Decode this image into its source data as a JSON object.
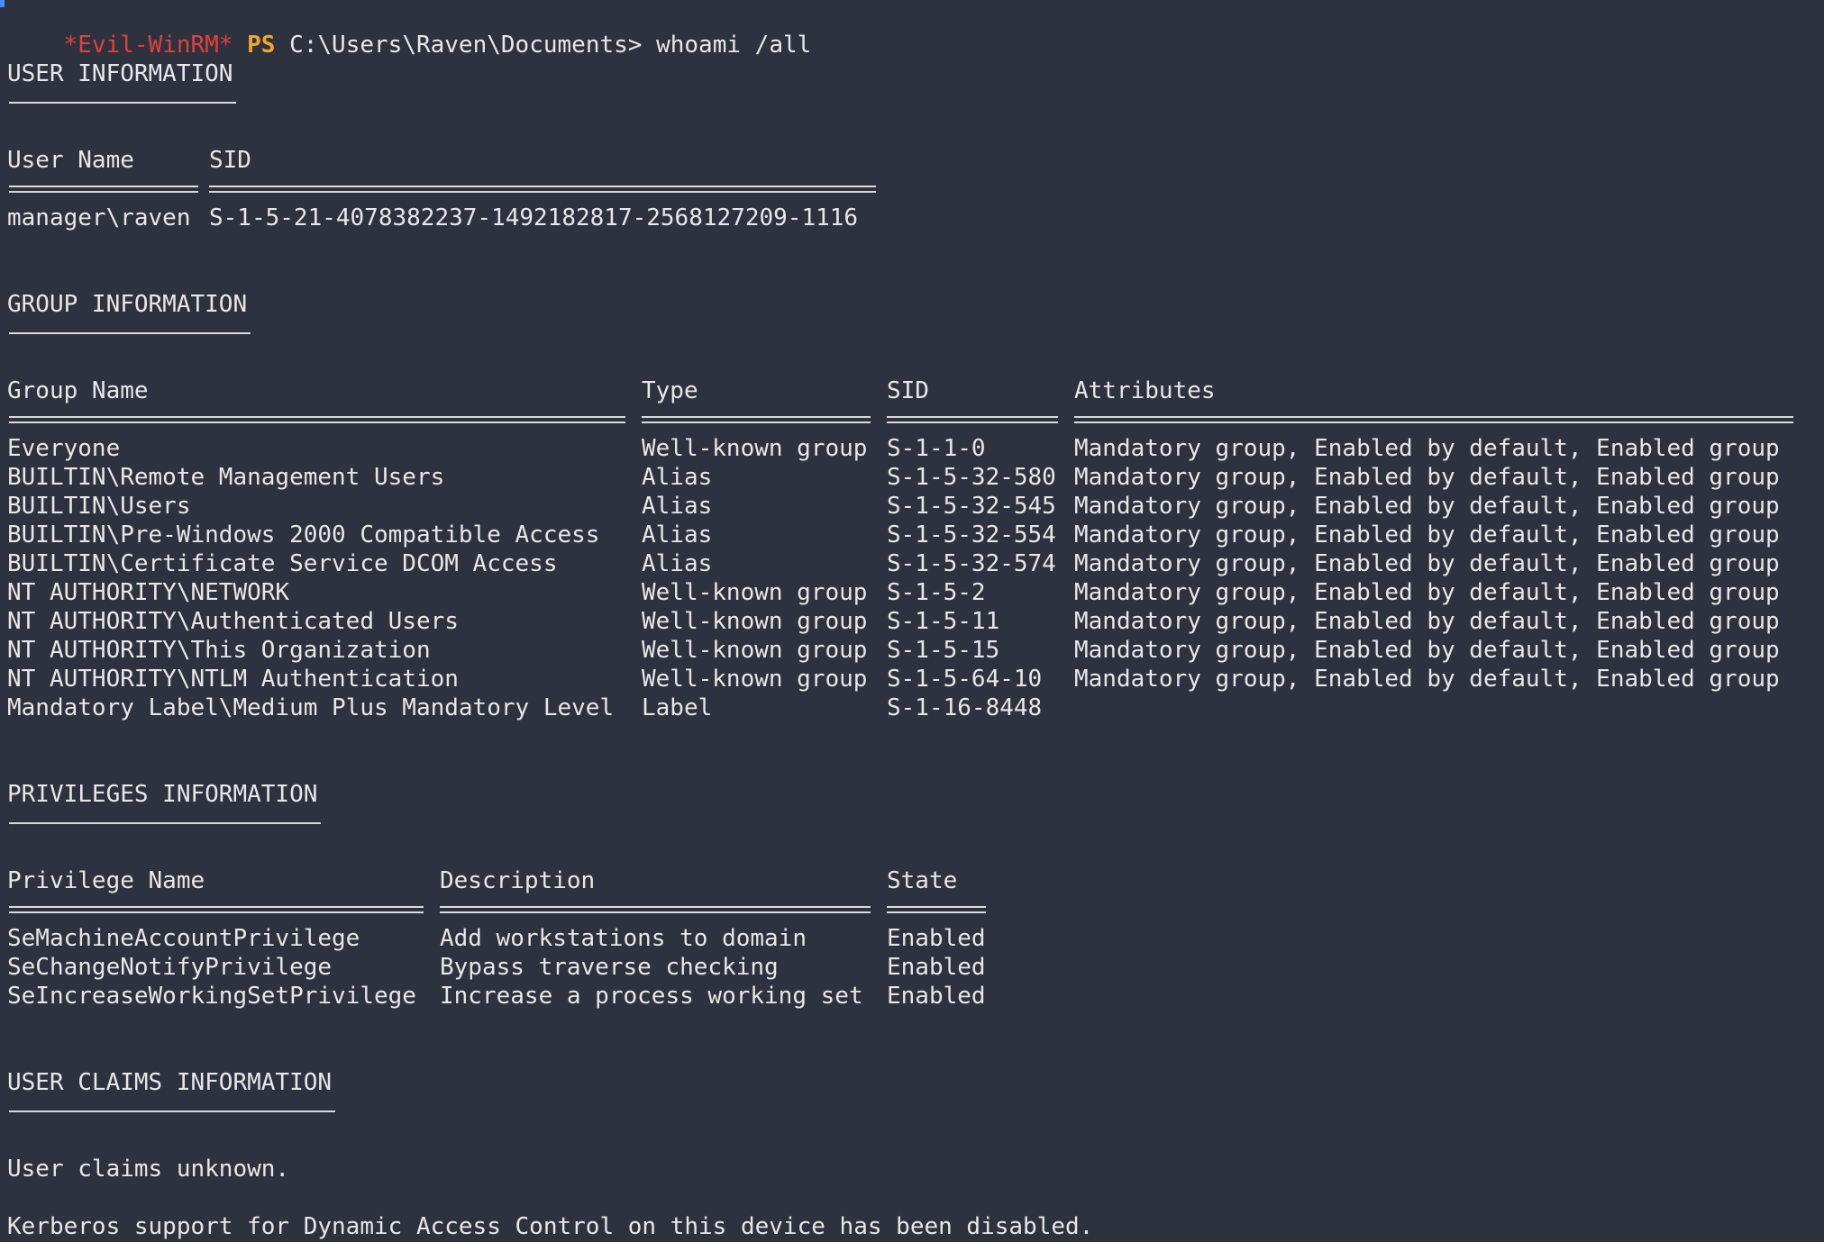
{
  "prompt": {
    "evil_tag": "*Evil-WinRM*",
    "ps_tag": "PS",
    "path": "C:\\Users\\Raven\\Documents>",
    "command": "whoami /all"
  },
  "user_info": {
    "heading": "USER INFORMATION",
    "headers": [
      "User Name",
      "SID"
    ],
    "row": {
      "user_name": "manager\\raven",
      "sid": "S-1-5-21-4078382237-1492182817-2568127209-1116"
    }
  },
  "group_info": {
    "heading": "GROUP INFORMATION",
    "headers": [
      "Group Name",
      "Type",
      "SID",
      "Attributes"
    ],
    "rows": [
      {
        "name": "Everyone",
        "type": "Well-known group",
        "sid": "S-1-1-0",
        "attrs": "Mandatory group, Enabled by default, Enabled group"
      },
      {
        "name": "BUILTIN\\Remote Management Users",
        "type": "Alias",
        "sid": "S-1-5-32-580",
        "attrs": "Mandatory group, Enabled by default, Enabled group"
      },
      {
        "name": "BUILTIN\\Users",
        "type": "Alias",
        "sid": "S-1-5-32-545",
        "attrs": "Mandatory group, Enabled by default, Enabled group"
      },
      {
        "name": "BUILTIN\\Pre-Windows 2000 Compatible Access",
        "type": "Alias",
        "sid": "S-1-5-32-554",
        "attrs": "Mandatory group, Enabled by default, Enabled group"
      },
      {
        "name": "BUILTIN\\Certificate Service DCOM Access",
        "type": "Alias",
        "sid": "S-1-5-32-574",
        "attrs": "Mandatory group, Enabled by default, Enabled group"
      },
      {
        "name": "NT AUTHORITY\\NETWORK",
        "type": "Well-known group",
        "sid": "S-1-5-2",
        "attrs": "Mandatory group, Enabled by default, Enabled group"
      },
      {
        "name": "NT AUTHORITY\\Authenticated Users",
        "type": "Well-known group",
        "sid": "S-1-5-11",
        "attrs": "Mandatory group, Enabled by default, Enabled group"
      },
      {
        "name": "NT AUTHORITY\\This Organization",
        "type": "Well-known group",
        "sid": "S-1-5-15",
        "attrs": "Mandatory group, Enabled by default, Enabled group"
      },
      {
        "name": "NT AUTHORITY\\NTLM Authentication",
        "type": "Well-known group",
        "sid": "S-1-5-64-10",
        "attrs": "Mandatory group, Enabled by default, Enabled group"
      },
      {
        "name": "Mandatory Label\\Medium Plus Mandatory Level",
        "type": "Label",
        "sid": "S-1-16-8448",
        "attrs": ""
      }
    ]
  },
  "privileges_info": {
    "heading": "PRIVILEGES INFORMATION",
    "headers": [
      "Privilege Name",
      "Description",
      "State"
    ],
    "rows": [
      {
        "name": "SeMachineAccountPrivilege",
        "desc": "Add workstations to domain",
        "state": "Enabled"
      },
      {
        "name": "SeChangeNotifyPrivilege",
        "desc": "Bypass traverse checking",
        "state": "Enabled"
      },
      {
        "name": "SeIncreaseWorkingSetPrivilege",
        "desc": "Increase a process working set",
        "state": "Enabled"
      }
    ]
  },
  "claims_info": {
    "heading": "USER CLAIMS INFORMATION",
    "claims_text": "User claims unknown.",
    "kerberos_text": "Kerberos support for Dynamic Access Control on this device has been disabled."
  },
  "colors": {
    "background": "#2e323e",
    "text": "#e6e7ea",
    "evil_tag": "#e0413a",
    "ps_tag": "#f0a531"
  }
}
